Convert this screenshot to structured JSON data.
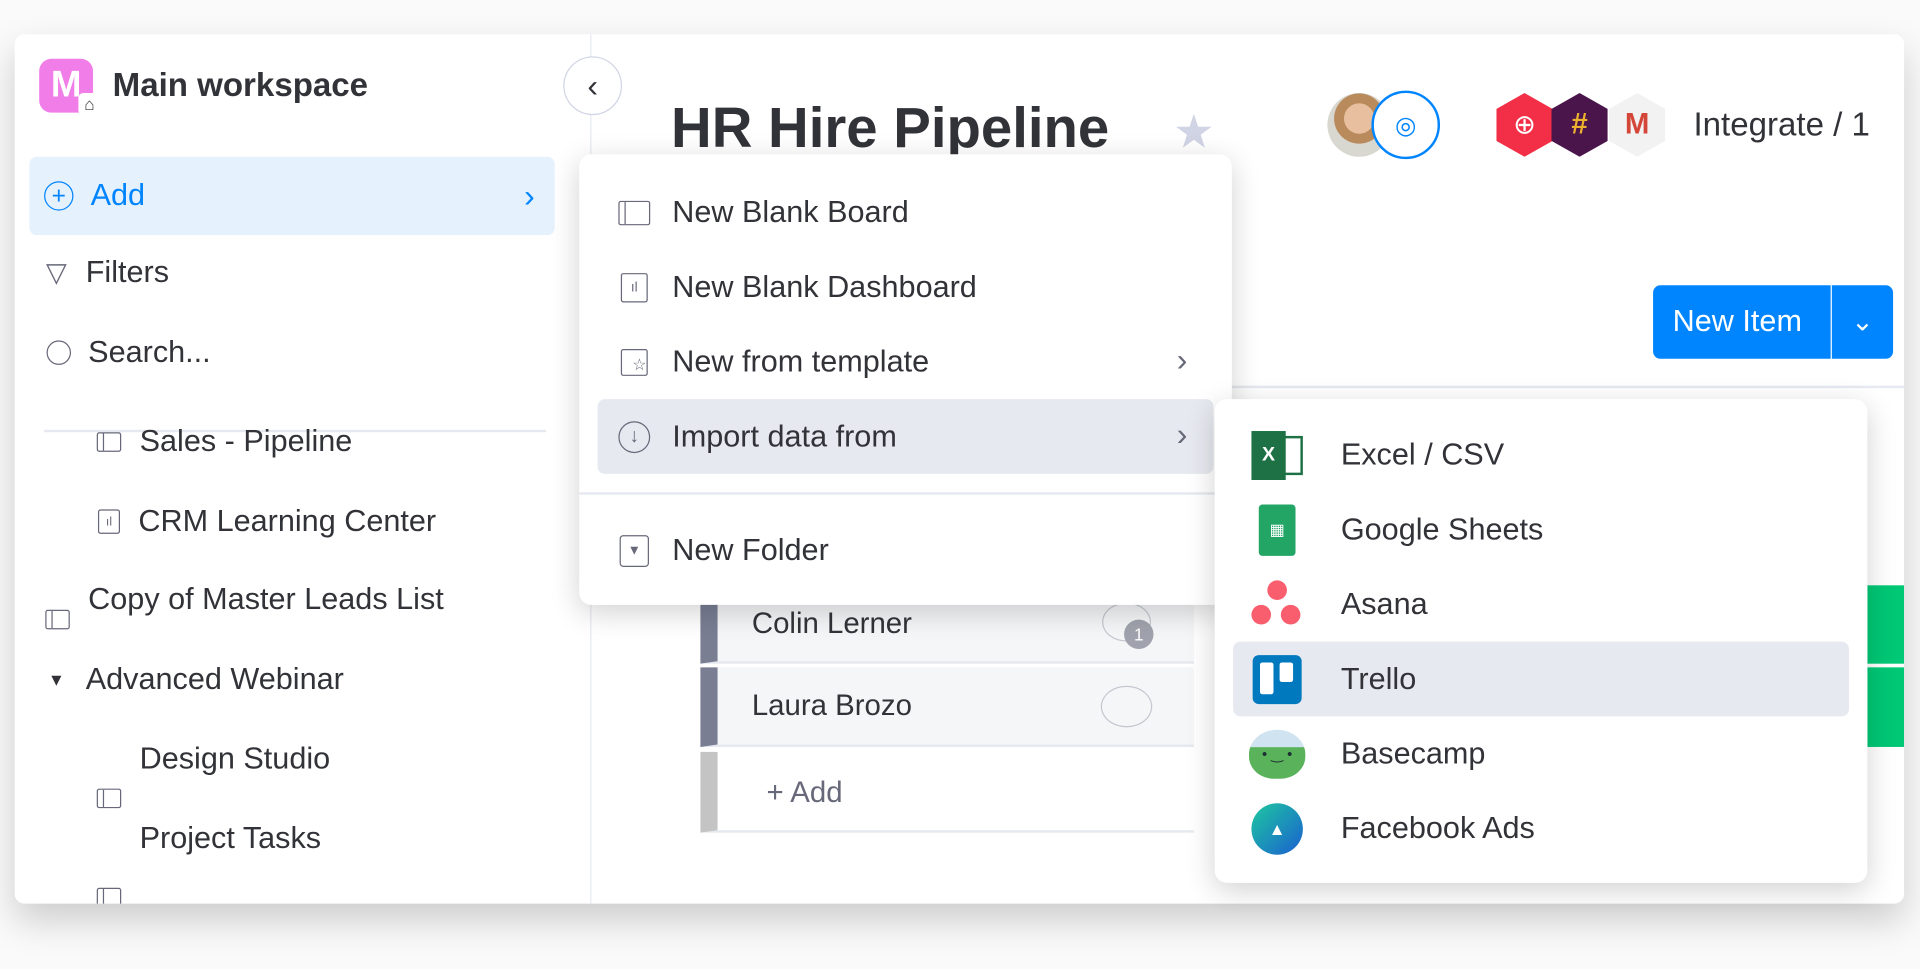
{
  "sidebar": {
    "workspace_name": "Main workspace",
    "workspace_initial": "M",
    "add_label": "Add",
    "filters_label": "Filters",
    "search_label": "Search...",
    "items": [
      {
        "label": "Sales - Pipeline",
        "icon": "board-icon"
      },
      {
        "label": "CRM Learning Center",
        "icon": "dashboard-icon"
      },
      {
        "label": "Copy of Master Leads List",
        "icon": "board-icon"
      },
      {
        "label": "Advanced Webinar",
        "icon": "folder-caret-icon"
      },
      {
        "label": "Design Studio",
        "icon": "board-icon"
      },
      {
        "label": "Project Tasks",
        "icon": "board-icon"
      }
    ]
  },
  "board": {
    "title": "HR Hire Pipeline",
    "integrate_label": "Integrate / 1",
    "new_item_label": "New Item",
    "rows": [
      {
        "name": "Colin Lerner",
        "comments": "1"
      },
      {
        "name": "Laura Brozo",
        "comments": ""
      }
    ],
    "add_row_label": "+ Add"
  },
  "add_menu": {
    "items": [
      {
        "label": "New Blank Board"
      },
      {
        "label": "New Blank Dashboard"
      },
      {
        "label": "New from template"
      },
      {
        "label": "Import data from"
      },
      {
        "label": "New Folder"
      }
    ]
  },
  "import_menu": {
    "items": [
      {
        "label": "Excel / CSV"
      },
      {
        "label": "Google Sheets"
      },
      {
        "label": "Asana"
      },
      {
        "label": "Trello"
      },
      {
        "label": "Basecamp"
      },
      {
        "label": "Facebook Ads"
      }
    ]
  },
  "colors": {
    "accent": "#0085ff",
    "highlight": "#e6e9ef",
    "add_bg": "#e5f1fd",
    "status_green": "#00c875"
  }
}
